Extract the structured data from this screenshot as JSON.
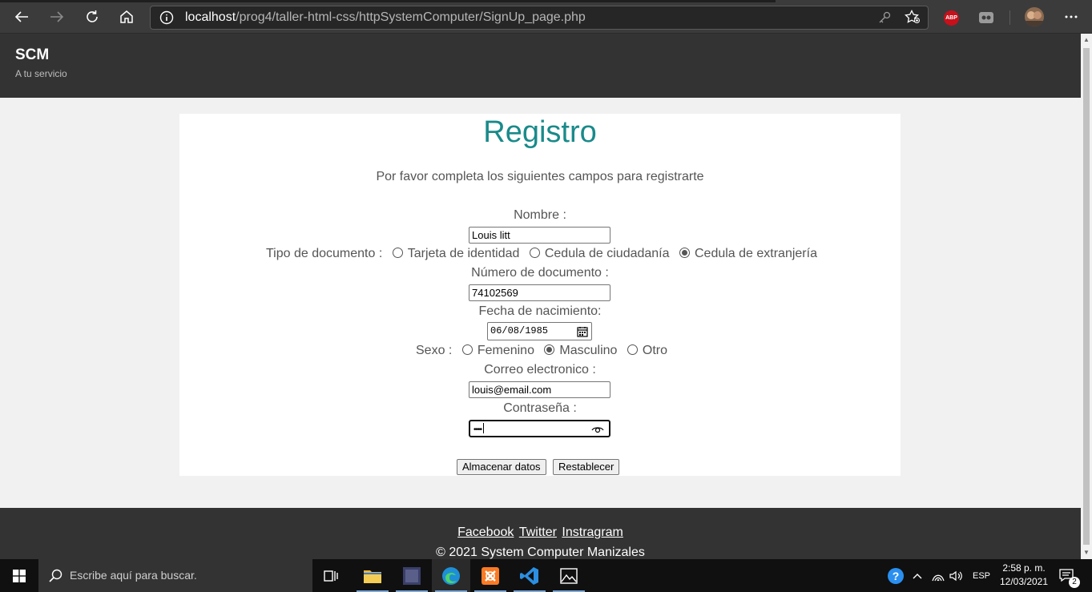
{
  "browser": {
    "url_host": "localhost",
    "url_path": "/prog4/taller-html-css/httpSystemComputer/SignUp_page.php",
    "extension_badge": "ABP"
  },
  "site": {
    "title": "SCM",
    "tagline": "A tu servicio"
  },
  "form": {
    "title": "Registro",
    "subtitle": "Por favor completa los siguientes campos para registrarte",
    "name_label": "Nombre :",
    "name_value": "Louis litt",
    "doc_type_label": "Tipo de documento :",
    "doc_type_options": [
      {
        "label": "Tarjeta de identidad",
        "checked": false
      },
      {
        "label": "Cedula de ciudadanía",
        "checked": false
      },
      {
        "label": "Cedula de extranjería",
        "checked": true
      }
    ],
    "doc_number_label": "Número de documento :",
    "doc_number_value": "74102569",
    "birth_label": "Fecha de nacimiento:",
    "birth_value": "06/08/1985",
    "sex_label": "Sexo :",
    "sex_options": [
      {
        "label": "Femenino",
        "checked": false
      },
      {
        "label": "Masculino",
        "checked": true
      },
      {
        "label": "Otro",
        "checked": false
      }
    ],
    "email_label": "Correo electronico :",
    "email_value": "louis@email.com",
    "password_label": "Contraseña :",
    "password_value": "••••",
    "submit_label": "Almacenar datos",
    "reset_label": "Restablecer"
  },
  "footer": {
    "links": [
      "Facebook",
      "Twitter",
      "Instragram"
    ],
    "copyright": "© 2021 System Computer Manizales"
  },
  "taskbar": {
    "search_placeholder": "Escribe aquí para buscar.",
    "language": "ESP",
    "time": "2:58 p. m.",
    "date": "12/03/2021",
    "notification_count": "2"
  },
  "colors": {
    "accent_title": "#1a8a8a",
    "header_bg": "#333333",
    "browser_bg": "#3b3b3b"
  }
}
